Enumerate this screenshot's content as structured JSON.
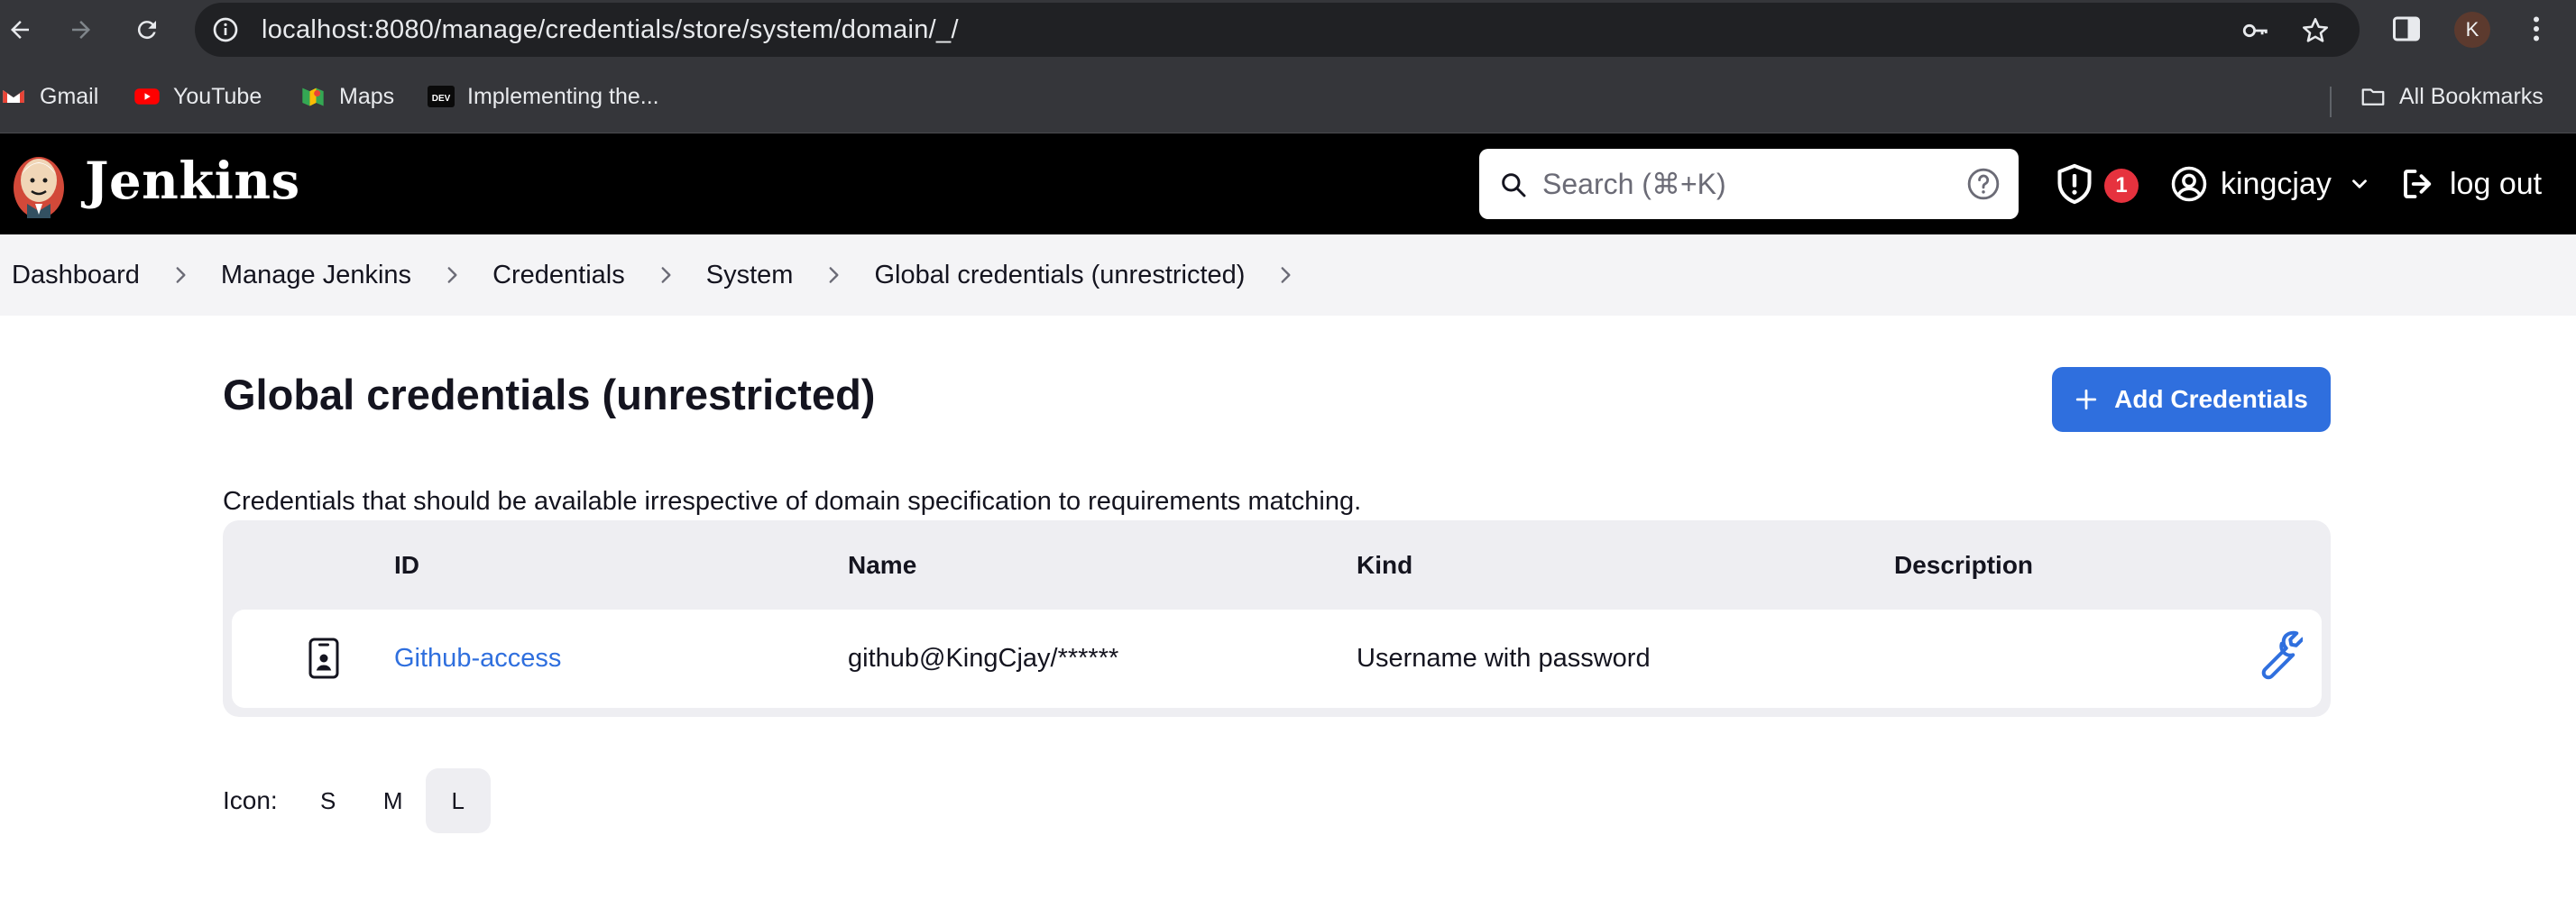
{
  "browser": {
    "url": "localhost:8080/manage/credentials/store/system/domain/_/",
    "profile_initial": "K",
    "bookmarks": [
      {
        "label": "Gmail",
        "icon": "gmail-icon"
      },
      {
        "label": "YouTube",
        "icon": "youtube-icon"
      },
      {
        "label": "Maps",
        "icon": "maps-icon"
      },
      {
        "label": "Implementing the...",
        "icon": "dev-icon"
      }
    ],
    "all_bookmarks_label": "All Bookmarks"
  },
  "header": {
    "title": "Jenkins",
    "search_placeholder": "Search (⌘+K)",
    "alert_count": "1",
    "username": "kingcjay",
    "logout_label": "log out"
  },
  "breadcrumb": [
    "Dashboard",
    "Manage Jenkins",
    "Credentials",
    "System",
    "Global credentials (unrestricted)"
  ],
  "main": {
    "title": "Global credentials (unrestricted)",
    "add_button_label": "Add Credentials",
    "description": "Credentials that should be available irrespective of domain specification to requirements matching.",
    "table": {
      "columns": [
        "ID",
        "Name",
        "Kind",
        "Description"
      ],
      "rows": [
        {
          "id": "Github-access",
          "name": "github@KingCjay/******",
          "kind": "Username with password",
          "description": ""
        }
      ]
    },
    "icon_size": {
      "label": "Icon:",
      "options": [
        "S",
        "M",
        "L"
      ],
      "selected": "L"
    }
  },
  "colors": {
    "accent": "#2f6fde",
    "header_bg": "#000000",
    "badge": "#e6323e"
  }
}
